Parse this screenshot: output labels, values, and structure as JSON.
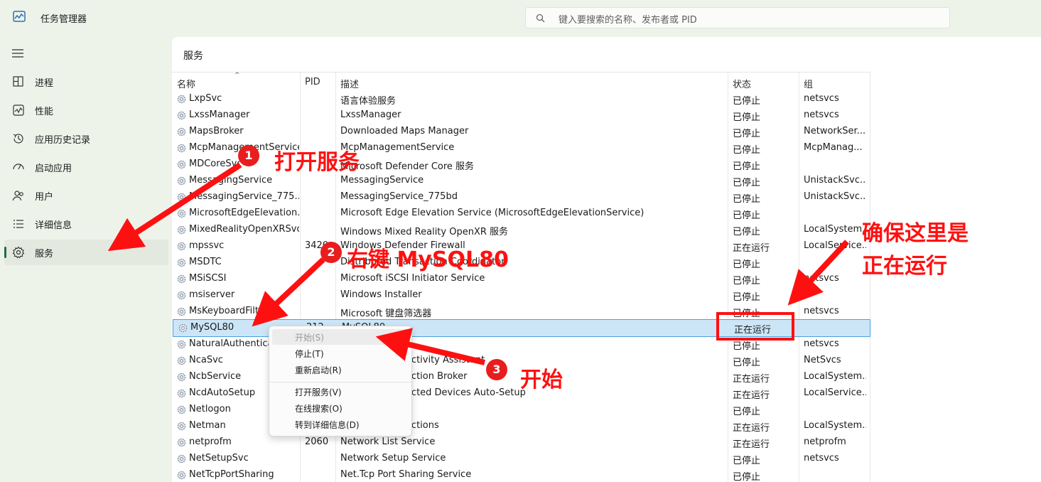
{
  "window": {
    "title": "任务管理器"
  },
  "search": {
    "placeholder": "键入要搜索的名称、发布者或 PID"
  },
  "sidebar": {
    "items": [
      {
        "label": "进程",
        "icon": "processes-icon"
      },
      {
        "label": "性能",
        "icon": "performance-icon"
      },
      {
        "label": "应用历史记录",
        "icon": "app-history-icon"
      },
      {
        "label": "启动应用",
        "icon": "startup-apps-icon"
      },
      {
        "label": "用户",
        "icon": "users-icon"
      },
      {
        "label": "详细信息",
        "icon": "details-icon"
      },
      {
        "label": "服务",
        "icon": "services-icon",
        "active": true
      }
    ]
  },
  "main": {
    "title": "服务",
    "columns": {
      "name": "名称",
      "pid": "PID",
      "desc": "描述",
      "status": "状态",
      "group": "组"
    },
    "rows": [
      {
        "name": "LxpSvc",
        "pid": "",
        "desc": "语言体验服务",
        "status": "已停止",
        "group": "netsvcs"
      },
      {
        "name": "LxssManager",
        "pid": "",
        "desc": "LxssManager",
        "status": "已停止",
        "group": "netsvcs"
      },
      {
        "name": "MapsBroker",
        "pid": "",
        "desc": "Downloaded Maps Manager",
        "status": "已停止",
        "group": "NetworkSer..."
      },
      {
        "name": "McpManagementService",
        "pid": "",
        "desc": "McpManagementService",
        "status": "已停止",
        "group": "McpManag..."
      },
      {
        "name": "MDCoreSvc",
        "pid": "",
        "desc": "Microsoft Defender Core 服务",
        "status": "已停止",
        "group": ""
      },
      {
        "name": "MessagingService",
        "pid": "",
        "desc": "MessagingService",
        "status": "已停止",
        "group": "UnistackSvc..."
      },
      {
        "name": "MessagingService_775...",
        "pid": "",
        "desc": "MessagingService_775bd",
        "status": "已停止",
        "group": "UnistackSvc..."
      },
      {
        "name": "MicrosoftEdgeElevation...",
        "pid": "",
        "desc": "Microsoft Edge Elevation Service (MicrosoftEdgeElevationService)",
        "status": "已停止",
        "group": ""
      },
      {
        "name": "MixedRealityOpenXRSvc",
        "pid": "",
        "desc": "Windows Mixed Reality OpenXR 服务",
        "status": "已停止",
        "group": "LocalSystem..."
      },
      {
        "name": "mpssvc",
        "pid": "3420",
        "desc": "Windows Defender Firewall",
        "status": "正在运行",
        "group": "LocalService..."
      },
      {
        "name": "MSDTC",
        "pid": "",
        "desc": "Distributed Transaction Coordinator",
        "status": "已停止",
        "group": ""
      },
      {
        "name": "MSiSCSI",
        "pid": "",
        "desc": "Microsoft iSCSI Initiator Service",
        "status": "已停止",
        "group": "netsvcs"
      },
      {
        "name": "msiserver",
        "pid": "",
        "desc": "Windows Installer",
        "status": "已停止",
        "group": ""
      },
      {
        "name": "MsKeyboardFilter",
        "pid": "",
        "desc": "Microsoft 键盘筛选器",
        "status": "已停止",
        "group": "netsvcs"
      },
      {
        "name": "MySQL80",
        "pid": "212",
        "desc": "MySQL80",
        "status": "正在运行",
        "group": "",
        "selected": true
      },
      {
        "name": "NaturalAuthentication",
        "pid": "",
        "desc": "",
        "status": "已停止",
        "group": "netsvcs"
      },
      {
        "name": "NcaSvc",
        "pid": "",
        "desc": "Network Connectivity Assistant",
        "status": "已停止",
        "group": "NetSvcs"
      },
      {
        "name": "NcbService",
        "pid": "",
        "desc": "Network Connection Broker",
        "status": "正在运行",
        "group": "LocalSystem..."
      },
      {
        "name": "NcdAutoSetup",
        "pid": "",
        "desc": "Network Connected Devices Auto-Setup",
        "status": "正在运行",
        "group": "LocalService..."
      },
      {
        "name": "Netlogon",
        "pid": "",
        "desc": "",
        "status": "已停止",
        "group": ""
      },
      {
        "name": "Netman",
        "pid": "",
        "desc": "Network Connections",
        "status": "正在运行",
        "group": "LocalSystem..."
      },
      {
        "name": "netprofm",
        "pid": "2060",
        "desc": "Network List Service",
        "status": "正在运行",
        "group": "netprofm"
      },
      {
        "name": "NetSetupSvc",
        "pid": "",
        "desc": "Network Setup Service",
        "status": "已停止",
        "group": "netsvcs"
      },
      {
        "name": "NetTcpPortSharing",
        "pid": "",
        "desc": "Net.Tcp Port Sharing Service",
        "status": "已停止",
        "group": ""
      }
    ]
  },
  "context_menu": {
    "items": [
      {
        "label": "开始(S)",
        "disabled": true
      },
      {
        "label": "停止(T)"
      },
      {
        "label": "重新启动(R)"
      },
      {
        "label": "打开服务(V)"
      },
      {
        "label": "在线搜索(O)"
      },
      {
        "label": "转到详细信息(D)"
      }
    ]
  },
  "annotations": {
    "step1_num": "1",
    "step1_text": "打开服务",
    "step2_num": "2",
    "step2_text": "右键 MySQL80",
    "step3_num": "3",
    "step3_text": "开始",
    "note_line1": "确保这里是",
    "note_line2": "正在运行",
    "color": "#ff1010"
  }
}
